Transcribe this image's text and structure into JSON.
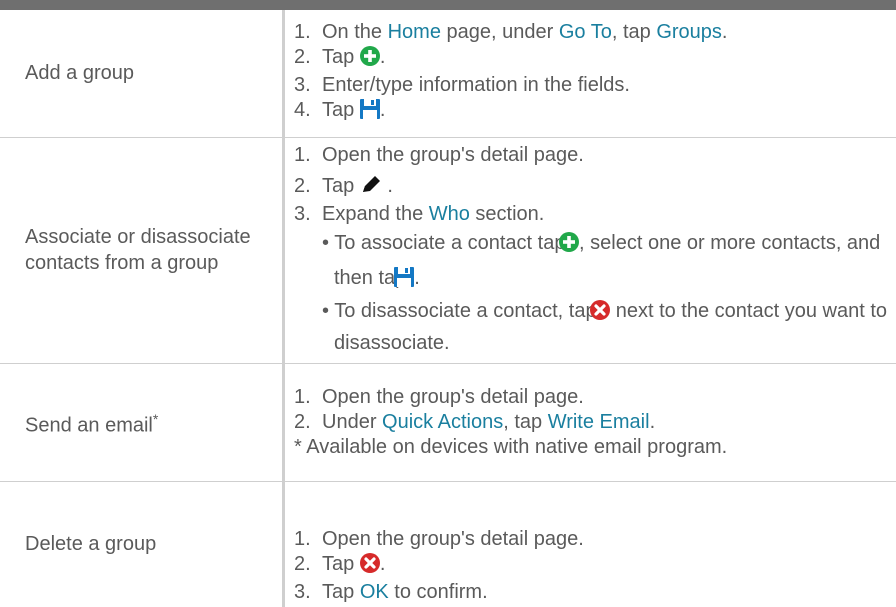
{
  "rows": [
    {
      "task": "Add a group",
      "steps": {
        "s1": {
          "num": "1.",
          "a": "On the ",
          "b": "Home",
          "c": " page, under ",
          "d": "Go To",
          "e": ", tap ",
          "f": "Groups",
          "g": "."
        },
        "s2": {
          "num": "2.",
          "a": "Tap",
          "end": "."
        },
        "s3": {
          "num": "3.",
          "a": "Enter/type information in the fields."
        },
        "s4": {
          "num": "4.",
          "a": "Tap",
          "end": "."
        }
      }
    },
    {
      "task": "Associate or disassociate contacts from a group",
      "steps": {
        "s1": {
          "num": "1.",
          "a": "Open the group's detail page."
        },
        "s2": {
          "num": "2.",
          "a": "Tap",
          "end": " ."
        },
        "s3": {
          "num": "3.",
          "a": "Expand the ",
          "b": "Who",
          "c": " section."
        },
        "b1": {
          "bullet": "•",
          "a": "To associate a contact tap ",
          "b": ", select one or more contacts, and then tap",
          "end": "."
        },
        "b2": {
          "bullet": "•",
          "a": "To disassociate a contact, tap ",
          "b": " next to the contact you want to disassociate."
        }
      }
    },
    {
      "task": "Send an email",
      "task_sup": "*",
      "steps": {
        "s1": {
          "num": "1.",
          "a": "Open the group's detail page."
        },
        "s2": {
          "num": "2.",
          "a": "Under ",
          "b": "Quick Actions",
          "c": ", tap ",
          "d": "Write Email",
          "e": "."
        },
        "note": "* Available on devices with native email program."
      }
    },
    {
      "task": "Delete a group",
      "steps": {
        "s1": {
          "num": "1.",
          "a": "Open the group's detail page."
        },
        "s2": {
          "num": "2.",
          "a": "Tap",
          "end": "."
        },
        "s3": {
          "num": "3.",
          "a": "Tap ",
          "b": "OK",
          "c": " to confirm."
        }
      }
    }
  ],
  "icons": {
    "add": "plus-circle-icon",
    "save": "save-icon",
    "edit": "pencil-icon",
    "remove": "x-circle-icon"
  },
  "colors": {
    "link": "#1a7f9f",
    "add": "#21a84a",
    "save": "#1478c4",
    "remove": "#d62a2a",
    "text": "#5a5a5a",
    "topbar": "#6f6f6f"
  }
}
